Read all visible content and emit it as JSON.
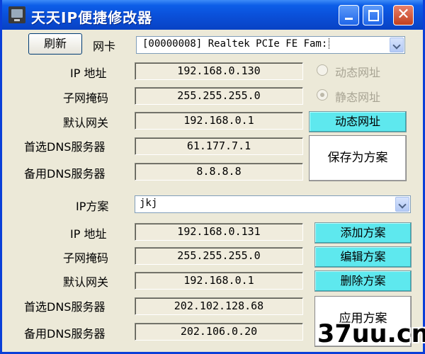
{
  "window": {
    "title": "天天IP便捷修改器",
    "close_glyph": "✕"
  },
  "top": {
    "refresh_label": "刷新",
    "nic_label": "网卡",
    "nic_value": "[00000008] Realtek PCIe FE Fam:",
    "ip_label": "IP 地址",
    "ip_value": "192.168.0.130",
    "mask_label": "子网掩码",
    "mask_value": "255.255.255.0",
    "gateway_label": "默认网关",
    "gateway_value": "192.168.0.1",
    "dns1_label": "首选DNS服务器",
    "dns1_value": "61.177.7.1",
    "dns2_label": "备用DNS服务器",
    "dns2_value": "8.8.8.8",
    "dynamic_radio_label": "动态网址",
    "static_radio_label": "静态网址",
    "dynamic_button_label": "动态网址",
    "save_scheme_label": "保存为方案"
  },
  "scheme": {
    "scheme_label": "IP方案",
    "scheme_value": "jkj",
    "ip_label": "IP 地址",
    "ip_value": "192.168.0.131",
    "mask_label": "子网掩码",
    "mask_value": "255.255.255.0",
    "gateway_label": "默认网关",
    "gateway_value": "192.168.0.1",
    "dns1_label": "首选DNS服务器",
    "dns1_value": "202.102.128.68",
    "dns2_label": "备用DNS服务器",
    "dns2_value": "202.106.0.20",
    "add_label": "添加方案",
    "edit_label": "编辑方案",
    "delete_label": "删除方案",
    "apply_label": "应用方案"
  },
  "watermark": "37uu.cn",
  "colors": {
    "titlebar": "#0a4fd8",
    "action_button": "#5ee8ee",
    "window_bg": "#ece9d8"
  }
}
